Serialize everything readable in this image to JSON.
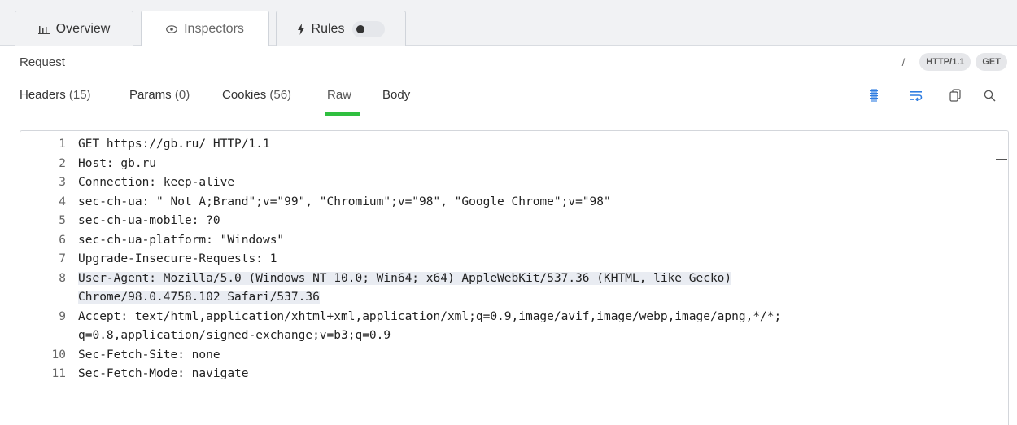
{
  "tabs": [
    {
      "label": "Overview",
      "icon": "bar-chart-icon"
    },
    {
      "label": "Inspectors",
      "icon": "eye-icon"
    },
    {
      "label": "Rules",
      "icon": "lightning-icon"
    }
  ],
  "request": {
    "label": "Request",
    "separator": "/",
    "protocol": "HTTP/1.1",
    "method": "GET"
  },
  "subtabs": [
    {
      "label": "Headers",
      "count": "(15)"
    },
    {
      "label": "Params",
      "count": "(0)"
    },
    {
      "label": "Cookies",
      "count": "(56)"
    },
    {
      "label": "Raw",
      "count": ""
    },
    {
      "label": "Body",
      "count": ""
    }
  ],
  "active_subtab": "Raw",
  "colors": {
    "accent": "#2fbf3f",
    "tool_blue": "#2f7de1",
    "highlight": "#e9ecf2"
  },
  "raw_lines": [
    {
      "n": "1",
      "text": "GET https://gb.ru/ HTTP/1.1"
    },
    {
      "n": "2",
      "text": "Host: gb.ru"
    },
    {
      "n": "3",
      "text": "Connection: keep-alive"
    },
    {
      "n": "4",
      "text": "sec-ch-ua: \" Not A;Brand\";v=\"99\", \"Chromium\";v=\"98\", \"Google Chrome\";v=\"98\""
    },
    {
      "n": "5",
      "text": "sec-ch-ua-mobile: ?0"
    },
    {
      "n": "6",
      "text": "sec-ch-ua-platform: \"Windows\""
    },
    {
      "n": "7",
      "text": "Upgrade-Insecure-Requests: 1"
    },
    {
      "n": "8",
      "text": "User-Agent: Mozilla/5.0 (Windows NT 10.0; Win64; x64) AppleWebKit/537.36 (KHTML, like Gecko)",
      "text2": "Chrome/98.0.4758.102 Safari/537.36",
      "highlight": true
    },
    {
      "n": "9",
      "text": "Accept: text/html,application/xhtml+xml,application/xml;q=0.9,image/avif,image/webp,image/apng,*/*;",
      "text2": "q=0.8,application/signed-exchange;v=b3;q=0.9"
    },
    {
      "n": "10",
      "text": "Sec-Fetch-Site: none"
    },
    {
      "n": "11",
      "text": "Sec-Fetch-Mode: navigate"
    }
  ]
}
